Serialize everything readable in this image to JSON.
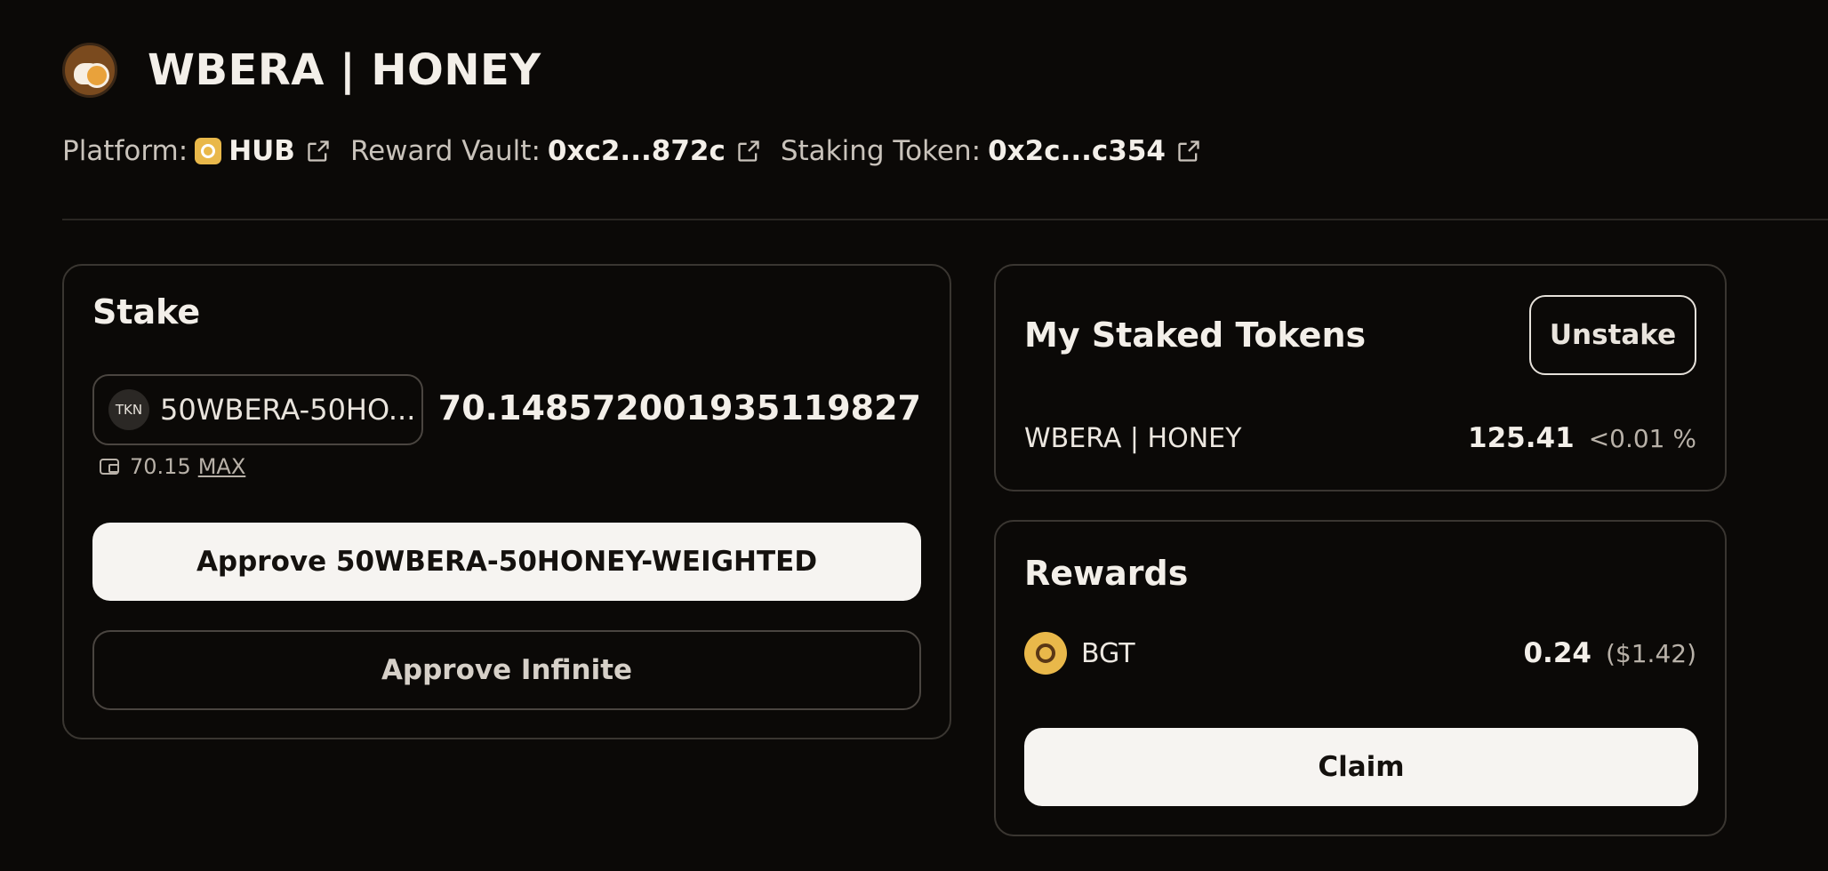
{
  "header": {
    "title": "WBERA | HONEY",
    "logo_icon": "wbera-honey-pool-icon"
  },
  "meta": {
    "platform_label": "Platform:",
    "platform_value": "HUB",
    "vault_label": "Reward Vault:",
    "vault_value": "0xc2...872c",
    "staking_label": "Staking Token:",
    "staking_value": "0x2c...c354"
  },
  "stake": {
    "title": "Stake",
    "token_icon_text": "TKN",
    "token_name": "50WBERA-50HO...",
    "amount": "70.148572001935119827",
    "balance": "70.15",
    "max_label": "MAX",
    "approve_label": "Approve 50WBERA-50HONEY-WEIGHTED",
    "approve_infinite_label": "Approve Infinite"
  },
  "staked": {
    "title": "My Staked Tokens",
    "unstake_label": "Unstake",
    "token": "WBERA | HONEY",
    "amount": "125.41",
    "share": "<0.01 %"
  },
  "rewards": {
    "title": "Rewards",
    "token": "BGT",
    "amount": "0.24",
    "usd": "($1.42)",
    "claim_label": "Claim"
  },
  "colors": {
    "background": "#0b0907",
    "card_border": "#3a3631",
    "primary_button": "#f6f4f1",
    "accent_gold": "#e9b84a"
  }
}
